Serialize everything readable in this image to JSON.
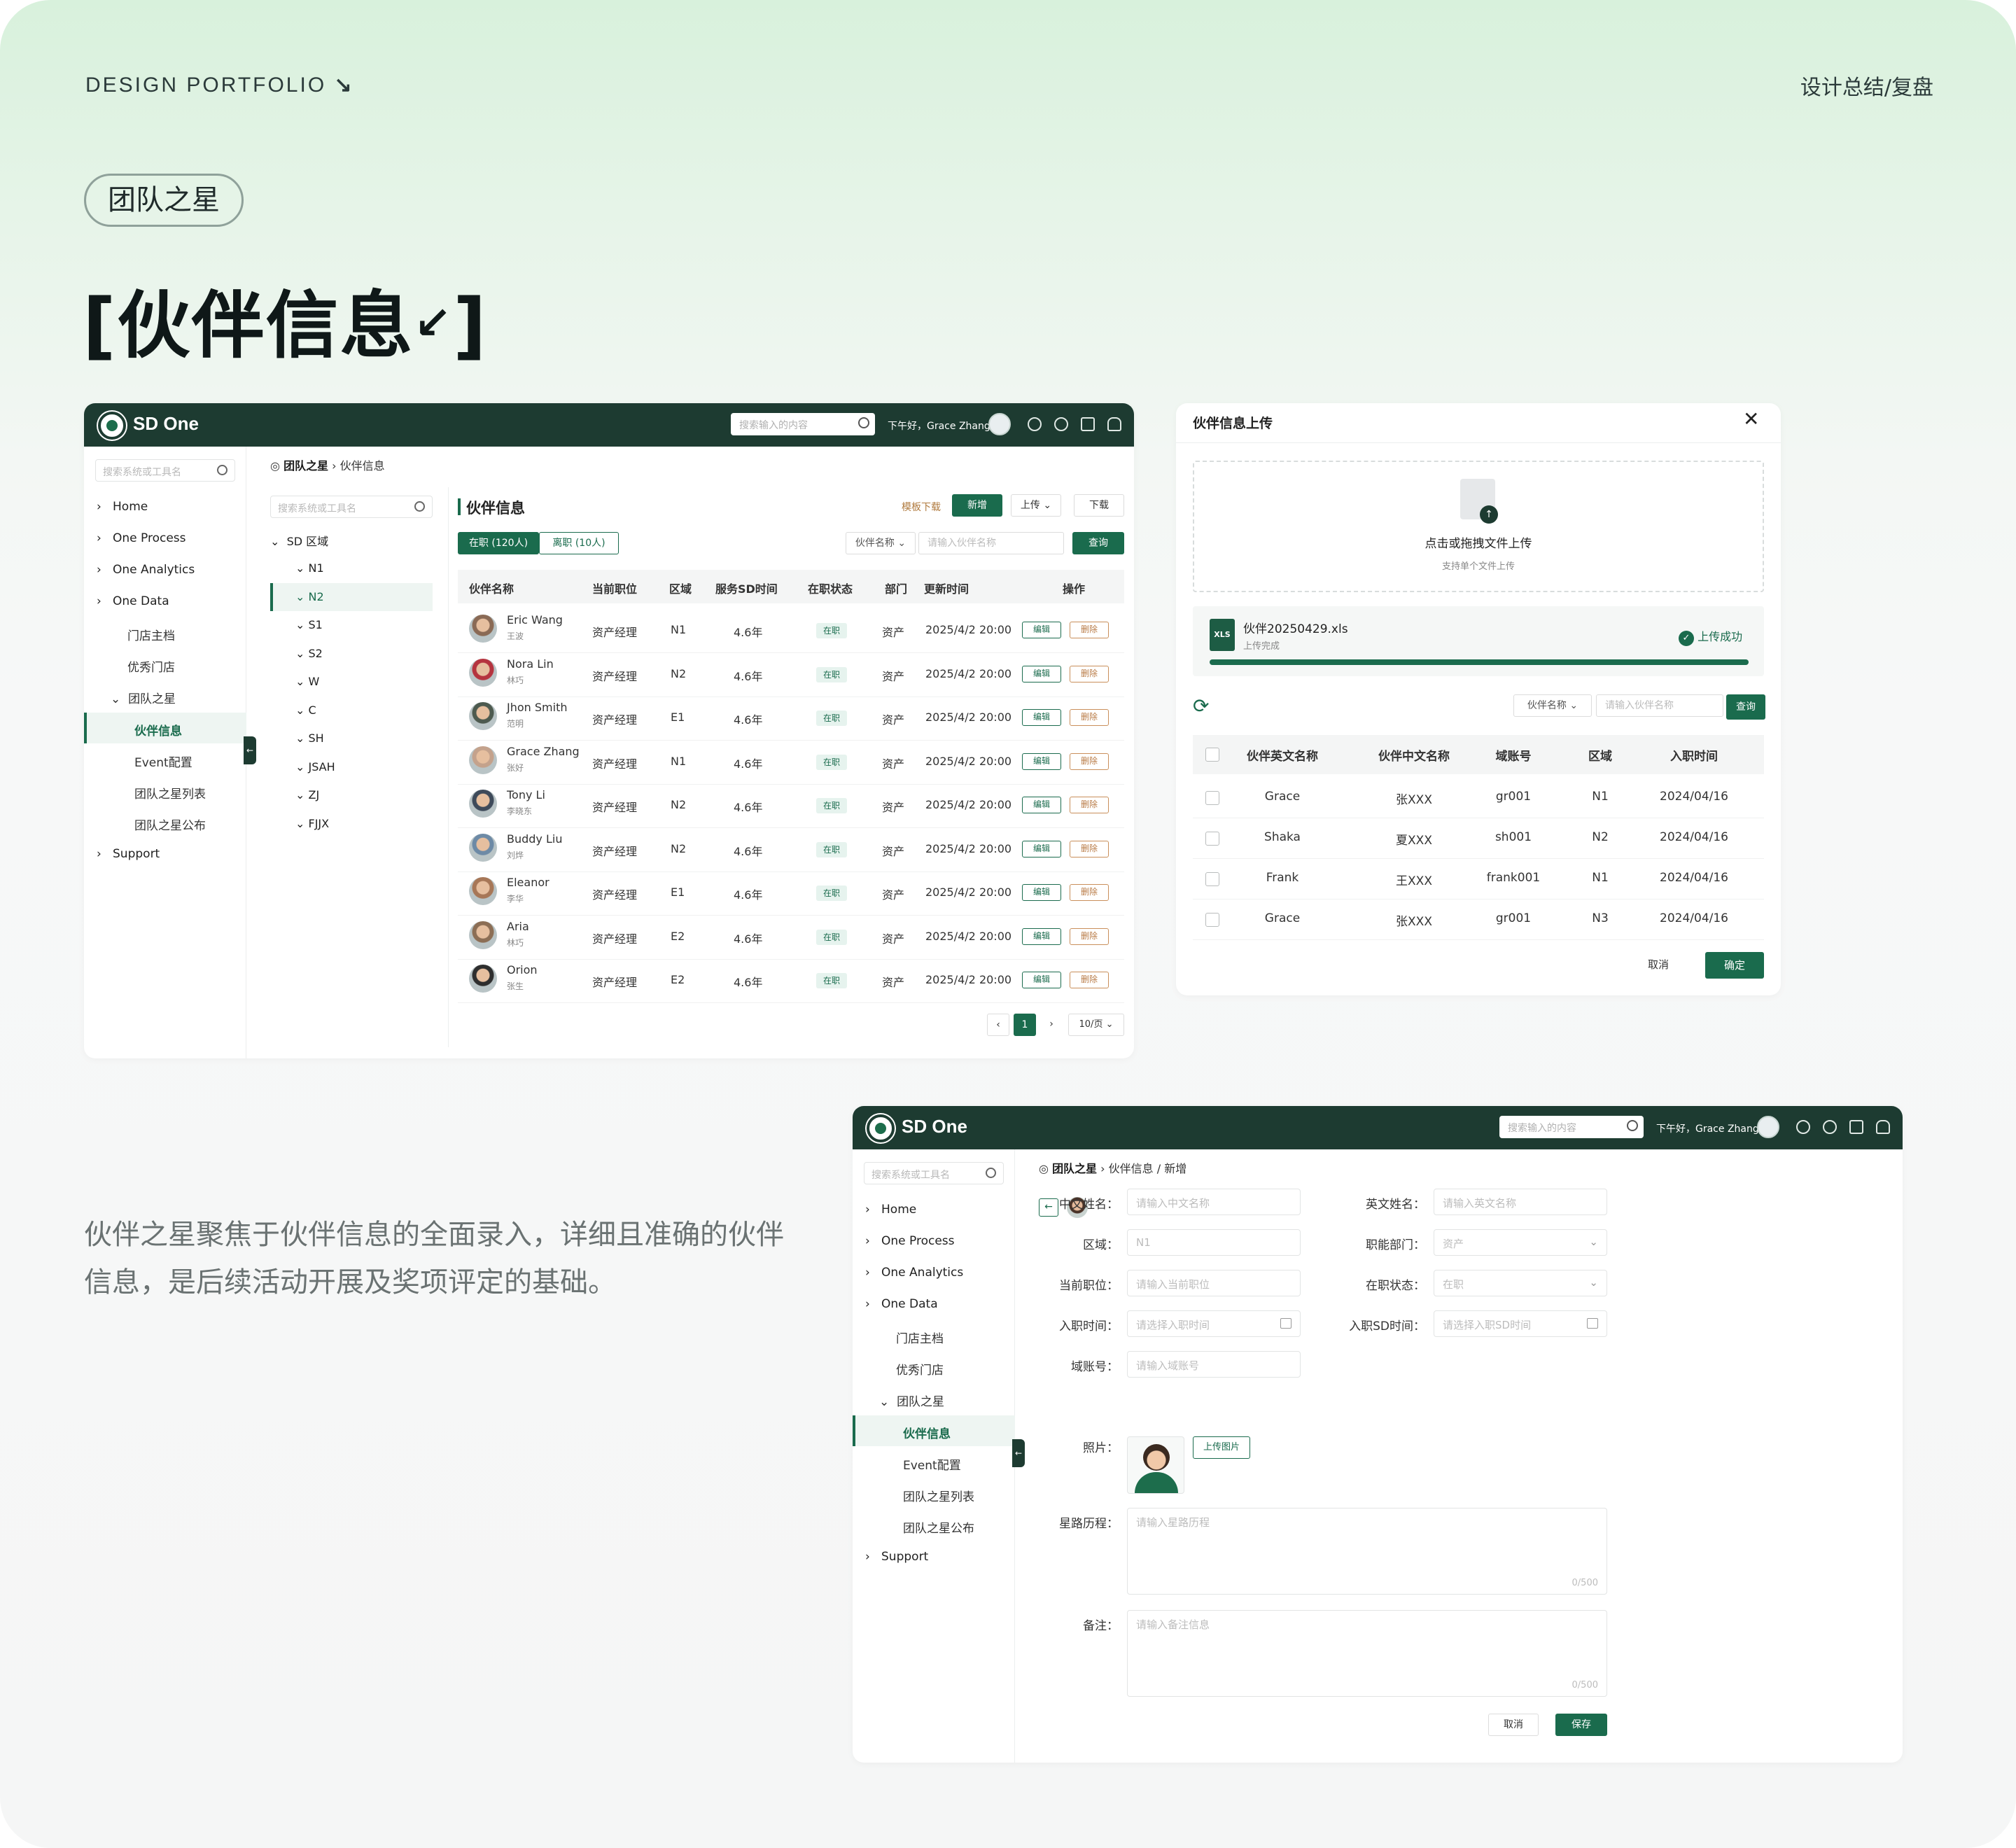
{
  "header": {
    "left_label": "DESIGN PORTFOLIO",
    "left_arrow": "↘",
    "right_label": "设计总结/复盘"
  },
  "section_pill": "团队之星",
  "page_title": "伙伴信息",
  "description": "伙伴之星聚焦于伙伴信息的全面录入，详细且准确的伙伴信息，是后续活动开展及奖项评定的基础。",
  "app": {
    "brand": "SD One",
    "search_placeholder": "搜索输入的内容",
    "greeting": "下午好，Grace Zhang",
    "sidebar_search_placeholder": "搜索系统或工具名",
    "nav": {
      "home": "Home",
      "one_process": "One Process",
      "one_analytics": "One Analytics",
      "one_data": "One Data",
      "store_archive": "门店主档",
      "excellent_store": "优秀门店",
      "team_star": "团队之星",
      "partner_info": "伙伴信息",
      "event_config": "Event配置",
      "star_list": "团队之星列表",
      "star_notice": "团队之星公布",
      "support": "Support"
    }
  },
  "list_window": {
    "breadcrumb_root": "团队之星",
    "breadcrumb_current": "伙伴信息",
    "tree_search_placeholder": "搜索系统或工具名",
    "tree_root": "SD 区域",
    "tree_items": [
      "N1",
      "N2",
      "S1",
      "S2",
      "W",
      "C",
      "SH",
      "JSAH",
      "ZJ",
      "FJJX"
    ],
    "title": "伙伴信息",
    "template_download": "模板下载",
    "add_button": "新增",
    "upload_button": "上传",
    "download_button": "下载",
    "tab_active": "在职 (120人)",
    "tab_inactive": "离职 (10人)",
    "filter_select": "伙伴名称",
    "filter_placeholder": "请输入伙伴名称",
    "query_button": "查询",
    "columns": [
      "伙伴名称",
      "当前职位",
      "区域",
      "服务SD时间",
      "在职状态",
      "部门",
      "更新时间",
      "操作"
    ],
    "rows": [
      {
        "en": "Eric Wang",
        "cn": "王波",
        "pos": "资产经理",
        "region": "N1",
        "time": "4.6年",
        "status": "在职",
        "dept": "资产",
        "updated": "2025/4/2 20:00"
      },
      {
        "en": "Nora Lin",
        "cn": "林巧",
        "pos": "资产经理",
        "region": "N2",
        "time": "4.6年",
        "status": "在职",
        "dept": "资产",
        "updated": "2025/4/2 20:00"
      },
      {
        "en": "Jhon Smith",
        "cn": "范明",
        "pos": "资产经理",
        "region": "E1",
        "time": "4.6年",
        "status": "在职",
        "dept": "资产",
        "updated": "2025/4/2 20:00"
      },
      {
        "en": "Grace Zhang",
        "cn": "张好",
        "pos": "资产经理",
        "region": "N1",
        "time": "4.6年",
        "status": "在职",
        "dept": "资产",
        "updated": "2025/4/2 20:00"
      },
      {
        "en": "Tony Li",
        "cn": "李晓东",
        "pos": "资产经理",
        "region": "N2",
        "time": "4.6年",
        "status": "在职",
        "dept": "资产",
        "updated": "2025/4/2 20:00"
      },
      {
        "en": "Buddy Liu",
        "cn": "刘烨",
        "pos": "资产经理",
        "region": "N2",
        "time": "4.6年",
        "status": "在职",
        "dept": "资产",
        "updated": "2025/4/2 20:00"
      },
      {
        "en": "Eleanor",
        "cn": "李华",
        "pos": "资产经理",
        "region": "E1",
        "time": "4.6年",
        "status": "在职",
        "dept": "资产",
        "updated": "2025/4/2 20:00"
      },
      {
        "en": "Aria",
        "cn": "林巧",
        "pos": "资产经理",
        "region": "E2",
        "time": "4.6年",
        "status": "在职",
        "dept": "资产",
        "updated": "2025/4/2 20:00"
      },
      {
        "en": "Orion",
        "cn": "张生",
        "pos": "资产经理",
        "region": "E2",
        "time": "4.6年",
        "status": "在职",
        "dept": "资产",
        "updated": "2025/4/2 20:00"
      }
    ],
    "edit_label": "编辑",
    "delete_label": "删除",
    "pagination": {
      "current": "1",
      "page_size": "10/页"
    }
  },
  "upload_dialog": {
    "title": "伙伴信息上传",
    "drop_title": "点击或拖拽文件上传",
    "drop_hint": "支持单个文件上传",
    "file_name": "伙伴20250429.xls",
    "file_badge": "XLS",
    "file_status": "上传完成",
    "success_text": "上传成功",
    "progress": 1.0,
    "filter_select": "伙伴名称",
    "filter_placeholder": "请输入伙伴名称",
    "query_button": "查询",
    "columns": [
      "伙伴英文名称",
      "伙伴中文名称",
      "域账号",
      "区域",
      "入职时间"
    ],
    "rows": [
      {
        "en": "Grace",
        "cn": "张XXX",
        "account": "gr001",
        "region": "N1",
        "date": "2024/04/16"
      },
      {
        "en": "Shaka",
        "cn": "夏XXX",
        "account": "sh001",
        "region": "N2",
        "date": "2024/04/16"
      },
      {
        "en": "Frank",
        "cn": "王XXX",
        "account": "frank001",
        "region": "N1",
        "date": "2024/04/16"
      },
      {
        "en": "Grace",
        "cn": "张XXX",
        "account": "gr001",
        "region": "N3",
        "date": "2024/04/16"
      }
    ],
    "cancel_button": "取消",
    "confirm_button": "确定"
  },
  "form_window": {
    "breadcrumb_root": "团队之星",
    "breadcrumb_current": "伙伴信息 / 新增",
    "labels": {
      "cn_name": "中文姓名：",
      "en_name": "英文姓名：",
      "region": "区域：",
      "dept": "职能部门：",
      "position": "当前职位：",
      "status": "在职状态：",
      "join_date": "入职时间：",
      "join_sd": "入职SD时间：",
      "account": "域账号：",
      "photo": "照片：",
      "journey": "星路历程：",
      "remark": "备注："
    },
    "placeholders": {
      "cn_name": "请输入中文名称",
      "en_name": "请输入英文名称",
      "region": "N1",
      "dept": "资产",
      "position": "请输入当前职位",
      "status": "在职",
      "join_date": "请选择入职时间",
      "join_sd": "请选择入职SD时间",
      "account": "请输入域账号",
      "journey": "请输入星路历程",
      "remark": "请输入备注信息"
    },
    "upload_photo": "上传图片",
    "counter": "0/500",
    "cancel_button": "取消",
    "save_button": "保存"
  }
}
